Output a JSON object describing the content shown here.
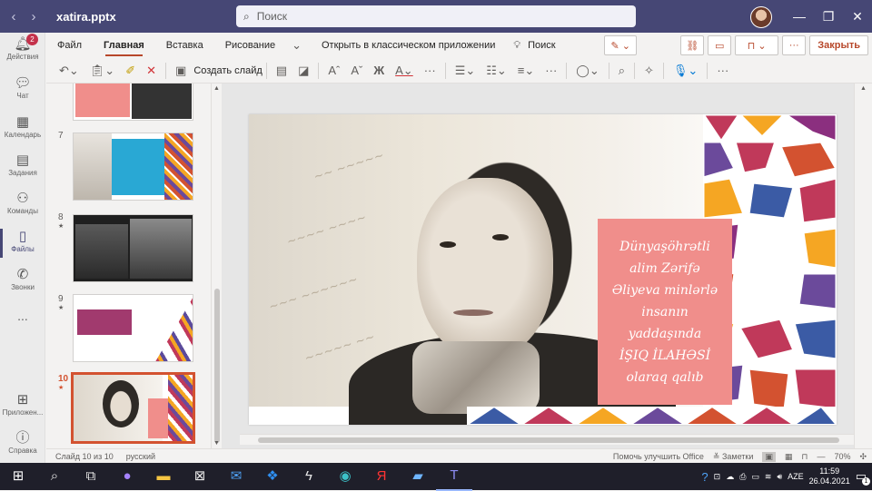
{
  "window": {
    "title": "xatira.pptx",
    "search_placeholder": "Поиск",
    "minimize": "—",
    "maximize": "❐",
    "close": "✕"
  },
  "rail": {
    "activity": {
      "label": "Действия",
      "badge": "2"
    },
    "chat": {
      "label": "Чат"
    },
    "calendar": {
      "label": "Календарь"
    },
    "tasks": {
      "label": "Задания"
    },
    "teams": {
      "label": "Команды"
    },
    "files": {
      "label": "Файлы"
    },
    "calls": {
      "label": "Звонки"
    },
    "more": {
      "label": "..."
    },
    "apps": {
      "label": "Приложен..."
    },
    "help": {
      "label": "Справка"
    }
  },
  "ribbon": {
    "tabs": [
      "Файл",
      "Главная",
      "Вставка",
      "Рисование"
    ],
    "open_desktop": "Открыть в классическом приложении",
    "search": "Поиск",
    "close_label": "Закрыть"
  },
  "toolbar": {
    "new_slide": "Создать слайд"
  },
  "slides": {
    "thumbnails": [
      {
        "num": "7",
        "mark": ""
      },
      {
        "num": "8",
        "mark": "★"
      },
      {
        "num": "9",
        "mark": "★"
      },
      {
        "num": "10",
        "mark": "★"
      }
    ]
  },
  "slide": {
    "text_lines": [
      "Dünyaşöhrətli",
      "alim Zərifə",
      "Əliyeva minlərlə",
      "insanın yaddaşında",
      "İŞIQ İLAHƏSİ",
      "olaraq qalıb"
    ]
  },
  "status": {
    "slide_count": "Слайд 10 из 10",
    "language": "русский",
    "improve": "Помочь улучшить Office",
    "notes": "Заметки",
    "zoom": "70%"
  },
  "taskbar": {
    "lang": "AZE",
    "time": "11:59",
    "date": "26.04.2021",
    "notif_count": "1"
  },
  "colors": {
    "title_bar": "#464775",
    "accent": "#b7472a",
    "slide_pink": "#f08e8b"
  }
}
